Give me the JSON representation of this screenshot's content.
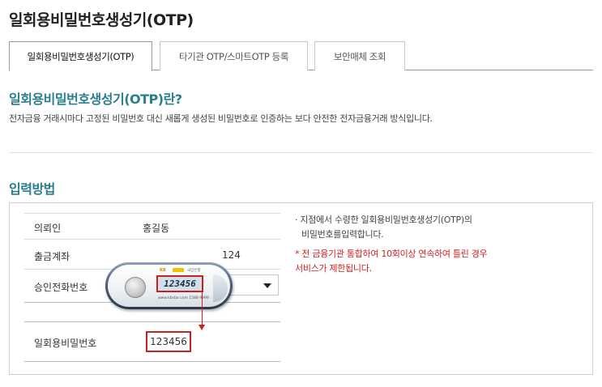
{
  "page": {
    "title": "일회용비밀번호생성기(OTP)"
  },
  "tabs": [
    {
      "label": "일회용비밀번호생성기(OTP)",
      "active": true
    },
    {
      "label": "타기관 OTP/스마트OTP 등록",
      "active": false
    },
    {
      "label": "보안매체 조회",
      "active": false
    }
  ],
  "intro": {
    "heading": "일회용비밀번호생성기(OTP)란?",
    "description": "전자금융 거래시마다 고정된 비밀번호 대신 새롭게 생성된 비밀번호로 인증하는 보다 안전한 전자금융거래 방식입니다."
  },
  "input_method": {
    "heading": "입력방법",
    "rows": [
      {
        "label": "의뢰인",
        "value": "홍길동"
      },
      {
        "label": "출금계좌",
        "value": "124"
      },
      {
        "label": "승인전화번호",
        "value": ""
      },
      {
        "label": "일회용비밀번호",
        "value": "123456"
      }
    ],
    "notes": {
      "line1": "· 지점에서 수령한 일회용비밀번호생성기(OTP)의",
      "line2": "비밀번호를입력합니다.",
      "warn1": "* 전 금융기관 통합하여 10회이상 연속하여 틀린 경우",
      "warn2": "서비스가 제한됩니다."
    }
  },
  "token": {
    "display": "123456",
    "logo": "KB",
    "brand": "국민은행",
    "small_text": "www.kbstar.com  1588-9999"
  },
  "colors": {
    "accent": "#2a7f8e",
    "warning": "#cc2222",
    "highlight_border": "#cc1f1f"
  }
}
